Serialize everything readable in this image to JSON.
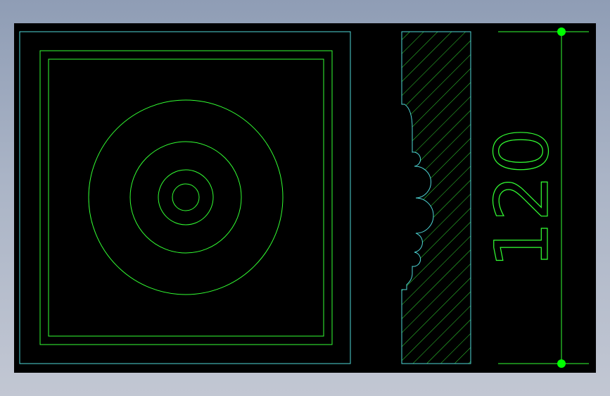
{
  "drawing": {
    "dimension_text": "120",
    "colors": {
      "background": "#000000",
      "outline_cyan": "#4fd8d8",
      "line_green": "#33ff33",
      "grip_green": "#00ff00",
      "hatch": "#33dd33"
    }
  }
}
